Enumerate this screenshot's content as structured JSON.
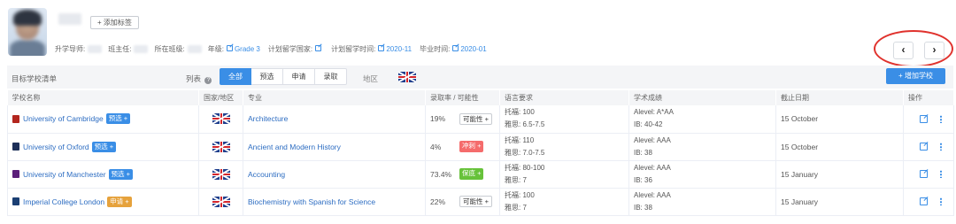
{
  "profile": {
    "add_tag": "+ 添加标签",
    "meta": {
      "advisor_label": "升学导师:",
      "head_teacher_label": "班主任:",
      "class_label": "所在班级:",
      "grade_label": "年级:",
      "grade_value": "Grade 3",
      "country_label": "计划留学国家:",
      "study_time_label": "计划留学时间:",
      "study_time_value": "2020-11",
      "graduation_label": "毕业时间:",
      "graduation_value": "2020-01"
    },
    "prev": "‹",
    "next": "›"
  },
  "toolbar": {
    "title": "目标学校清单",
    "list_label": "列表",
    "help": "?",
    "tabs": [
      "全部",
      "预选",
      "申请",
      "录取"
    ],
    "active_tab": "全部",
    "region_label": "地区",
    "add_school": "+ 增加学校"
  },
  "table": {
    "columns": [
      "学校名称",
      "国家/地区",
      "专业",
      "录取率 / 可能性",
      "语言要求",
      "学术成绩",
      "截止日期",
      "操作"
    ],
    "rows": [
      {
        "school": "University of Cambridge",
        "status": "预选 +",
        "status_color": "#3a8ee6",
        "icon_color": "#b3261e",
        "major": "Architecture",
        "rate": "19%",
        "chance": "可能性 +",
        "chance_style": "plain",
        "lang1": "托福: 100",
        "lang2": "雅思: 6.5-7.5",
        "acad1": "Alevel: A*AA",
        "acad2": "IB: 40-42",
        "deadline": "15 October"
      },
      {
        "school": "University of Oxford",
        "status": "预选 +",
        "status_color": "#3a8ee6",
        "icon_color": "#1d2f58",
        "major": "Ancient and Modern History",
        "rate": "4%",
        "chance": "冲刺 +",
        "chance_style": "red",
        "lang1": "托福: 110",
        "lang2": "雅思: 7.0-7.5",
        "acad1": "Alevel: AAA",
        "acad2": "IB: 38",
        "deadline": "15 October"
      },
      {
        "school": "University of Manchester",
        "status": "预选 +",
        "status_color": "#3a8ee6",
        "icon_color": "#5b1f7a",
        "major": "Accounting",
        "rate": "73.4%",
        "chance": "保底 +",
        "chance_style": "green",
        "lang1": "托福: 80-100",
        "lang2": "雅思: 7",
        "acad1": "Alevel: AAA",
        "acad2": "IB: 36",
        "deadline": "15 January"
      },
      {
        "school": "Imperial College London",
        "status": "申请 +",
        "status_color": "#e6a23c",
        "icon_color": "#1b3f73",
        "major": "Biochemistry with Spanish for Science",
        "rate": "22%",
        "chance": "可能性 +",
        "chance_style": "plain",
        "lang1": "托福: 100",
        "lang2": "雅思: 7",
        "acad1": "Alevel: AAA",
        "acad2": "IB: 38",
        "deadline": "15 January"
      }
    ]
  }
}
